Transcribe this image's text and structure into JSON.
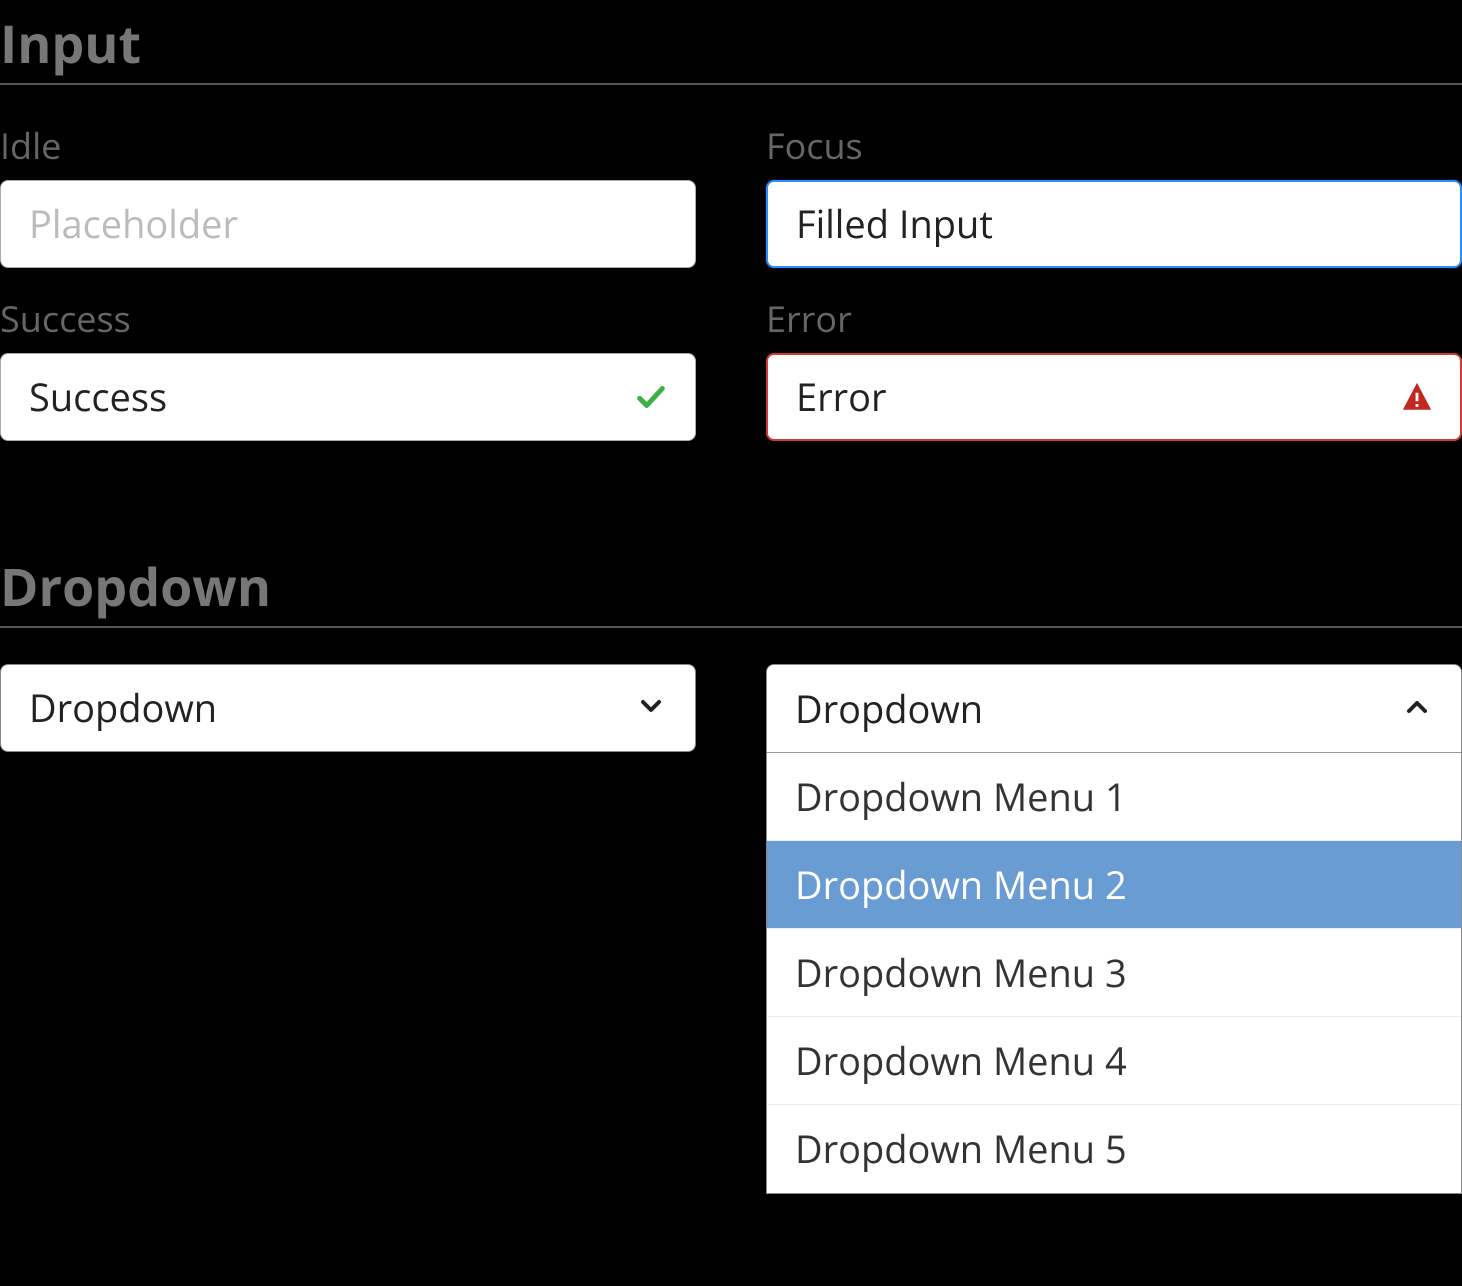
{
  "sections": {
    "input": {
      "title": "Input",
      "fields": {
        "idle": {
          "label": "Idle",
          "placeholder": "Placeholder",
          "value": ""
        },
        "focus": {
          "label": "Focus",
          "value": "Filled Input"
        },
        "success": {
          "label": "Success",
          "value": "Success"
        },
        "error": {
          "label": "Error",
          "value": "Error"
        }
      }
    },
    "dropdown": {
      "title": "Dropdown",
      "closed": {
        "label": "Dropdown"
      },
      "open": {
        "label": "Dropdown",
        "selected_index": 1,
        "items": [
          "Dropdown Menu 1",
          "Dropdown Menu 2",
          "Dropdown Menu 3",
          "Dropdown Menu 4",
          "Dropdown Menu 5"
        ]
      }
    }
  },
  "colors": {
    "focus_border": "#2a8cff",
    "error_border": "#d33a2f",
    "success_check": "#3cb043",
    "error_triangle": "#c1281f",
    "dropdown_selected_bg": "#6a9cd4"
  }
}
